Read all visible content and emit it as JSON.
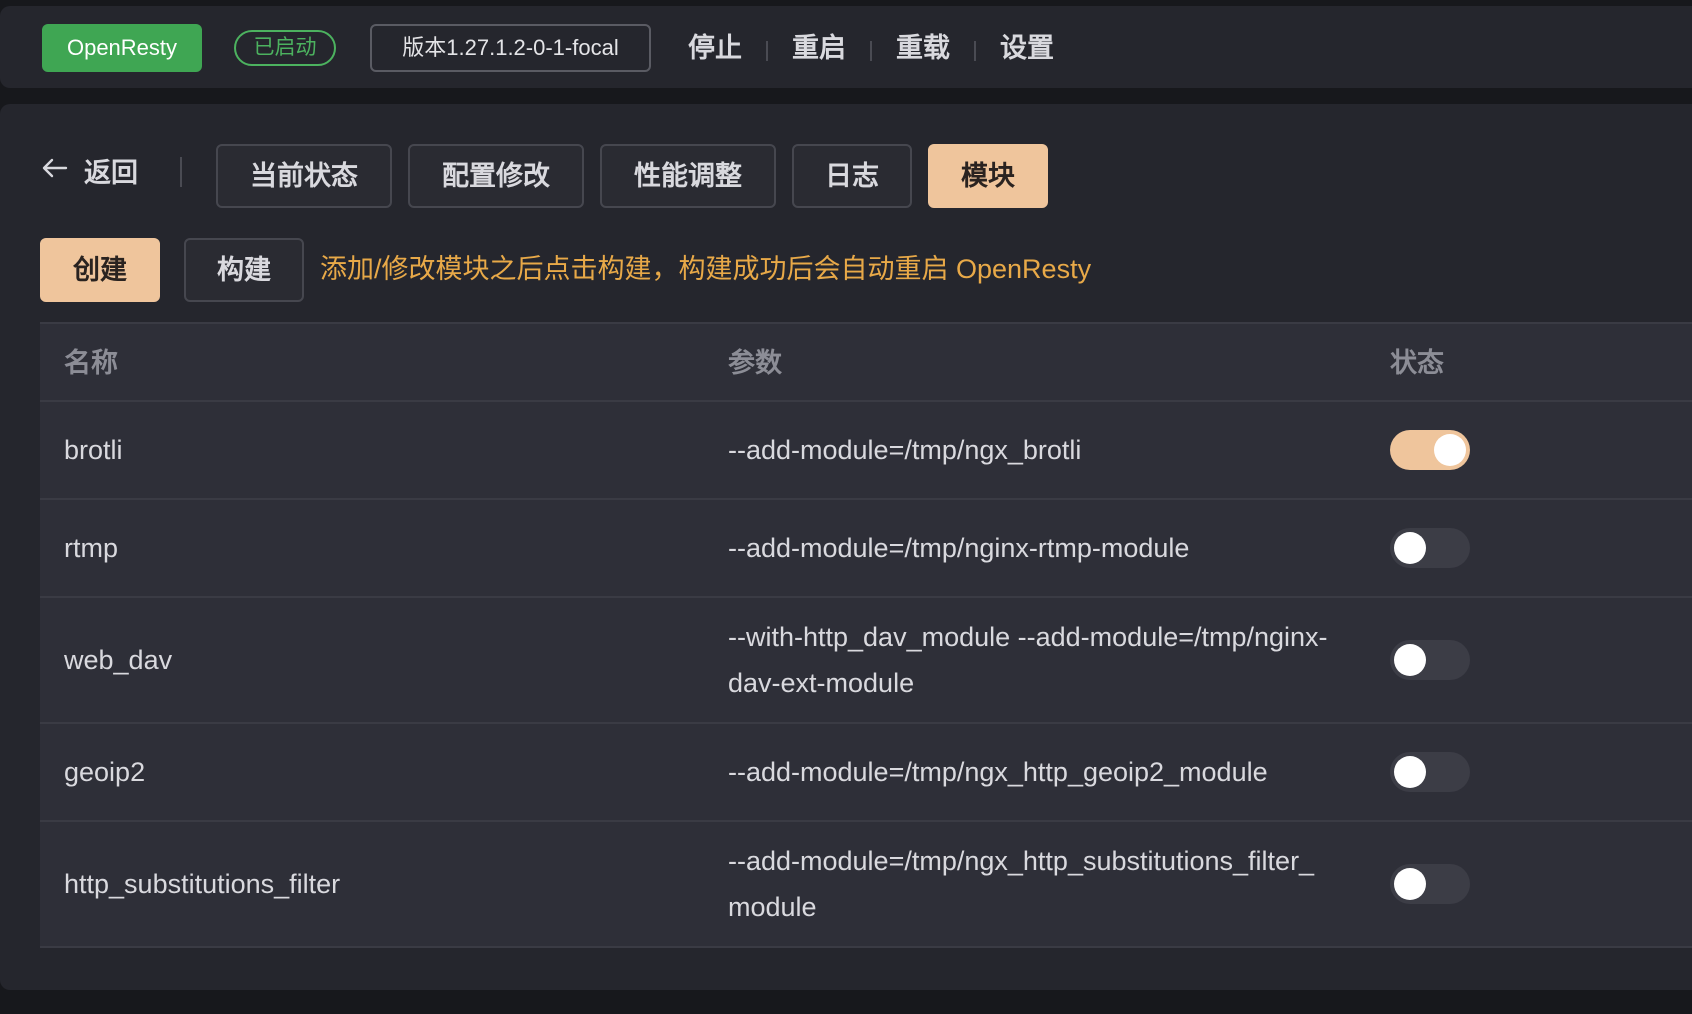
{
  "topbar": {
    "app_name": "OpenResty",
    "status": "已启动",
    "version": "版本1.27.1.2-0-1-focal",
    "actions": [
      "停止",
      "重启",
      "重载",
      "设置"
    ]
  },
  "nav": {
    "back_label": "返回",
    "tabs": [
      "当前状态",
      "配置修改",
      "性能调整",
      "日志",
      "模块"
    ],
    "active_tab": "模块"
  },
  "toolbar": {
    "create_label": "创建",
    "build_label": "构建",
    "hint": "添加/修改模块之后点击构建，构建成功后会自动重启 OpenResty"
  },
  "table": {
    "headers": [
      "名称",
      "参数",
      "状态"
    ],
    "rows": [
      {
        "name": "brotli",
        "params": "--add-module=/tmp/ngx_brotli",
        "enabled": true
      },
      {
        "name": "rtmp",
        "params": "--add-module=/tmp/nginx-rtmp-module",
        "enabled": false
      },
      {
        "name": "web_dav",
        "params": "--with-http_dav_module --add-module=/tmp/nginx-dav-ext-module",
        "enabled": false
      },
      {
        "name": "geoip2",
        "params": "--add-module=/tmp/ngx_http_geoip2_module",
        "enabled": false
      },
      {
        "name": "http_substitutions_filter",
        "params": "--add-module=/tmp/ngx_http_substitutions_filter_module",
        "enabled": false
      }
    ]
  },
  "colors": {
    "app_tag": "#3fa653",
    "accent": "#efc59c",
    "hint": "#e8a948"
  }
}
